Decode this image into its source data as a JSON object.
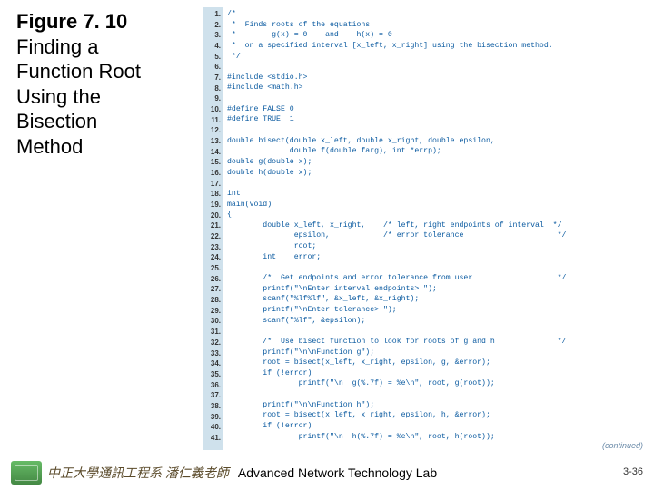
{
  "title": {
    "figure_label": "Figure 7. 10",
    "caption_l1": "Finding a",
    "caption_l2": "Function Root",
    "caption_l3": "Using the",
    "caption_l4": "Bisection",
    "caption_l5": "Method"
  },
  "code": {
    "lines": [
      "/*",
      " *  Finds roots of the equations",
      " *        g(x) = 0    and    h(x) = 0",
      " *  on a specified interval [x_left, x_right] using the bisection method.",
      " */",
      "",
      "#include <stdio.h>",
      "#include <math.h>",
      "",
      "#define FALSE 0",
      "#define TRUE  1",
      "",
      "double bisect(double x_left, double x_right, double epsilon,",
      "              double f(double farg), int *errp);",
      "double g(double x);",
      "double h(double x);",
      "",
      "int",
      "main(void)",
      "{",
      "        double x_left, x_right,    /* left, right endpoints of interval  */",
      "               epsilon,            /* error tolerance                     */",
      "               root;",
      "        int    error;",
      "",
      "        /*  Get endpoints and error tolerance from user                   */",
      "        printf(\"\\nEnter interval endpoints> \");",
      "        scanf(\"%lf%lf\", &x_left, &x_right);",
      "        printf(\"\\nEnter tolerance> \");",
      "        scanf(\"%lf\", &epsilon);",
      "",
      "        /*  Use bisect function to look for roots of g and h              */",
      "        printf(\"\\n\\nFunction g\");",
      "        root = bisect(x_left, x_right, epsilon, g, &error);",
      "        if (!error)",
      "                printf(\"\\n  g(%.7f) = %e\\n\", root, g(root));",
      "",
      "        printf(\"\\n\\nFunction h\");",
      "        root = bisect(x_left, x_right, epsilon, h, &error);",
      "        if (!error)",
      "                printf(\"\\n  h(%.7f) = %e\\n\", root, h(root));"
    ],
    "continued": "(continued)"
  },
  "footer": {
    "cn": "中正大學通訊工程系 潘仁義老師",
    "en": "Advanced Network Technology Lab",
    "page": "3-36"
  }
}
